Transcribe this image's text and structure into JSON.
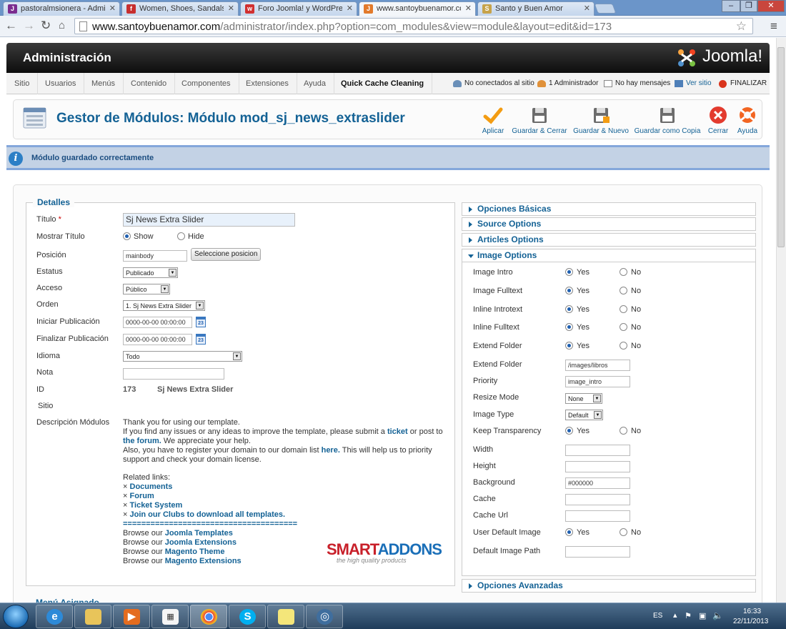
{
  "browser": {
    "tabs": [
      {
        "title": "pastoralmsionera - Admin",
        "color": "#7b2c8f",
        "glyph": "J"
      },
      {
        "title": "Women, Shoes, Sandals -",
        "color": "#c72f2f",
        "glyph": "f"
      },
      {
        "title": "Foro Joomla! y WordPress",
        "color": "#d13030",
        "glyph": "w"
      },
      {
        "title": "www.santoybuenamor.co",
        "color": "#e27a2b",
        "glyph": "J"
      },
      {
        "title": "Santo y Buen Amor",
        "color": "#c7a34a",
        "glyph": "S"
      }
    ],
    "url_host": "www.santoybuenamor.com",
    "url_path": "/administrator/index.php?option=com_modules&view=module&layout=edit&id=173",
    "icons": {
      "back": "back-arrow-icon",
      "forward": "forward-arrow-icon",
      "reload": "reload-icon",
      "home": "home-icon",
      "star": "bookmark-star-icon",
      "menu": "menu-icon"
    }
  },
  "admin": {
    "title": "Administración",
    "brand": "Joomla!",
    "menu": [
      "Sitio",
      "Usuarios",
      "Menús",
      "Contenido",
      "Componentes",
      "Extensiones",
      "Ayuda",
      "Quick Cache Cleaning"
    ],
    "status": [
      "No conectados al sitio",
      "1 Administrador",
      "No hay mensajes",
      "Ver sitio",
      "FINALIZAR"
    ]
  },
  "page": {
    "title": "Gestor de Módulos: Módulo mod_sj_news_extraslider",
    "toolbar": [
      "Aplicar",
      "Guardar & Cerrar",
      "Guardar & Nuevo",
      "Guardar como Copia",
      "Cerrar",
      "Ayuda"
    ]
  },
  "message": "Módulo guardado correctamente",
  "details": {
    "legend": "Detalles",
    "titulo_label": "Título",
    "required_mark": "*",
    "titulo_value": "Sj News Extra Slider",
    "mostrar_label": "Mostrar Título",
    "show": "Show",
    "hide": "Hide",
    "posicion_label": "Posición",
    "posicion_value": "mainbody",
    "posicion_button": "Seleccione posicion",
    "estatus_label": "Estatus",
    "estatus_value": "Publicado",
    "acceso_label": "Acceso",
    "acceso_value": "Público",
    "orden_label": "Orden",
    "orden_value": "1. Sj News Extra Slider",
    "iniciar_label": "Iniciar Publicación",
    "iniciar_value": "0000-00-00 00:00:00",
    "finalizar_label": "Finalizar Publicación",
    "finalizar_value": "0000-00-00 00:00:00",
    "calendar_day": "23",
    "idioma_label": "Idioma",
    "idioma_value": "Todo",
    "nota_label": "Nota",
    "nota_value": "",
    "id_label": "ID",
    "id_value": "173",
    "id_name": "Sj News Extra Slider",
    "sitio_label": "Sitio",
    "descripcion_label": "Descripción Módulos",
    "desc_line1": "Thank you for using our template.",
    "desc_line2_a": "If you find any issues or any ideas to improve the template, please submit a",
    "desc_line2_link": "ticket",
    "desc_line2_b": "or post to",
    "desc_line3_link": "the forum.",
    "desc_line3_b": "We appreciate your help.",
    "desc_line4_a": "Also, you have to register your domain to our domain list",
    "desc_line4_link": "here.",
    "desc_line4_b": "This will help us to priority",
    "desc_line5": "support and check your domain license.",
    "related_title": "Related links:",
    "related_bullet": "×",
    "related": [
      "Documents",
      "Forum",
      "Ticket System",
      "Join our Clubs to download all templates."
    ],
    "separator": "======================================",
    "browse_prefix": "Browse our",
    "browse": [
      "Joomla Templates",
      "Joomla Extensions",
      "Magento Theme",
      "Magento Extensions"
    ],
    "logo_part1": "SMART",
    "logo_part2": "ADDONS",
    "logo_tagline": "the high quality products"
  },
  "cut_off_label": "Menú Asignado",
  "accordion": {
    "sections": [
      "Opciones Básicas",
      "Source Options",
      "Articles Options",
      "Image Options",
      "Opciones Avanzadas"
    ],
    "yes": "Yes",
    "no": "No",
    "image_options": {
      "image_intro_label": "Image Intro",
      "image_intro_value": "Yes",
      "image_fulltext_label": "Image Fulltext",
      "image_fulltext_value": "Yes",
      "inline_introtext_label": "Inline Introtext",
      "inline_introtext_value": "Yes",
      "inline_fulltext_label": "Inline Fulltext",
      "inline_fulltext_value": "Yes",
      "extend_folder_toggle_label": "Extend Folder",
      "extend_folder_toggle_value": "Yes",
      "extend_folder_label": "Extend Folder",
      "extend_folder_value": "/images/libros",
      "priority_label": "Priority",
      "priority_value": "image_intro",
      "resize_mode_label": "Resize Mode",
      "resize_mode_value": "None",
      "image_type_label": "Image Type",
      "image_type_value": "Default",
      "keep_transparency_label": "Keep Transparency",
      "keep_transparency_value": "Yes",
      "width_label": "Width",
      "width_value": "",
      "height_label": "Height",
      "height_value": "",
      "background_label": "Background",
      "background_value": "#000000",
      "cache_label": "Cache",
      "cache_value": "",
      "cache_url_label": "Cache Url",
      "cache_url_value": "",
      "user_default_image_label": "User Default Image",
      "user_default_image_value": "Yes",
      "default_image_path_label": "Default Image Path",
      "default_image_path_value": ""
    }
  },
  "taskbar": {
    "apps": [
      "internet-explorer",
      "file-explorer",
      "media-player",
      "calculator",
      "chrome",
      "skype",
      "sticky-notes",
      "network"
    ],
    "language": "ES",
    "time": "16:33",
    "date": "22/11/2013"
  }
}
